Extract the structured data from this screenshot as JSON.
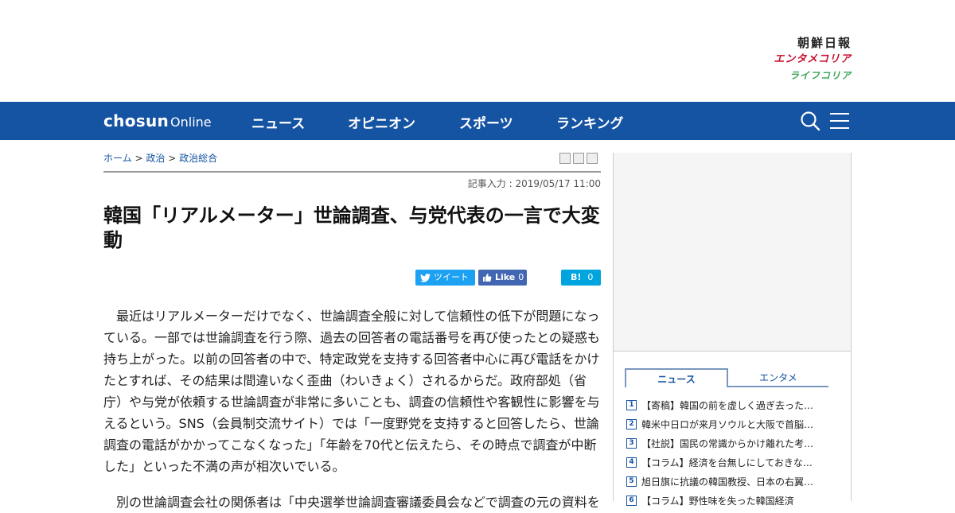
{
  "brands": {
    "main": "朝鮮日報",
    "entame": "エンタメコリア",
    "life": "ライフコリア"
  },
  "nav": {
    "logo_main": "chosun",
    "logo_sub": "Online",
    "items": [
      "ニュース",
      "オピニオン",
      "スポーツ",
      "ランキング"
    ],
    "search_icon": "search-icon",
    "menu_icon": "hamburger-menu-icon",
    "bg_color": "#1553a3"
  },
  "breadcrumb": {
    "items": [
      "ホーム",
      "政治",
      "政治総合"
    ],
    "separator": ">"
  },
  "article": {
    "date": "記事入力 : 2019/05/17 11:00",
    "title": "韓国「リアルメーター」世論調査、与党代表の一言で大変動",
    "share": {
      "tweet_label": "ツイート",
      "like_label": "Like",
      "like_count": "0",
      "hatena_label": "B!",
      "hatena_count": "0"
    },
    "paragraph1": "最近はリアルメーターだけでなく、世論調査全般に対して信頼性の低下が問題になっている。一部では世論調査を行う際、過去の回答者の電話番号を再び使ったとの疑惑も持ち上がった。以前の回答者の中で、特定政党を支持する回答者中心に再び電話をかけたとすれば、その結果は間違いなく歪曲（わいきょく）されるからだ。政府部処（省庁）や与党が依頼する世論調査が非常に多いことも、調査の信頼性や客観性に影響を与えるという。SNS（会員制交流サイト）では「一度野党を支持すると回答したら、世論調査の電話がかかってこなくなった」「年齢を70代と伝えたら、その時点で調査が中断した」といった不満の声が相次いでいる。",
    "paragraph2": "別の世論調査会社の関係者は「中央選挙世論調査審議委員会などで調査の元の資料を"
  },
  "sidebar": {
    "tabs": [
      "ニュース",
      "エンタメ"
    ],
    "ranking": [
      {
        "num": "1",
        "title": "【寄稿】韓国の前を虚しく過ぎ去った…"
      },
      {
        "num": "2",
        "title": "韓米中日ロが来月ソウルと大阪で首脳…"
      },
      {
        "num": "3",
        "title": "【社説】国民の常識からかけ離れた考…"
      },
      {
        "num": "4",
        "title": "【コラム】経済を台無しにしておきな…"
      },
      {
        "num": "5",
        "title": "旭日旗に抗議の韓国教授、日本の右翼…"
      },
      {
        "num": "6",
        "title": "【コラム】野性味を失った韓国経済"
      }
    ]
  }
}
